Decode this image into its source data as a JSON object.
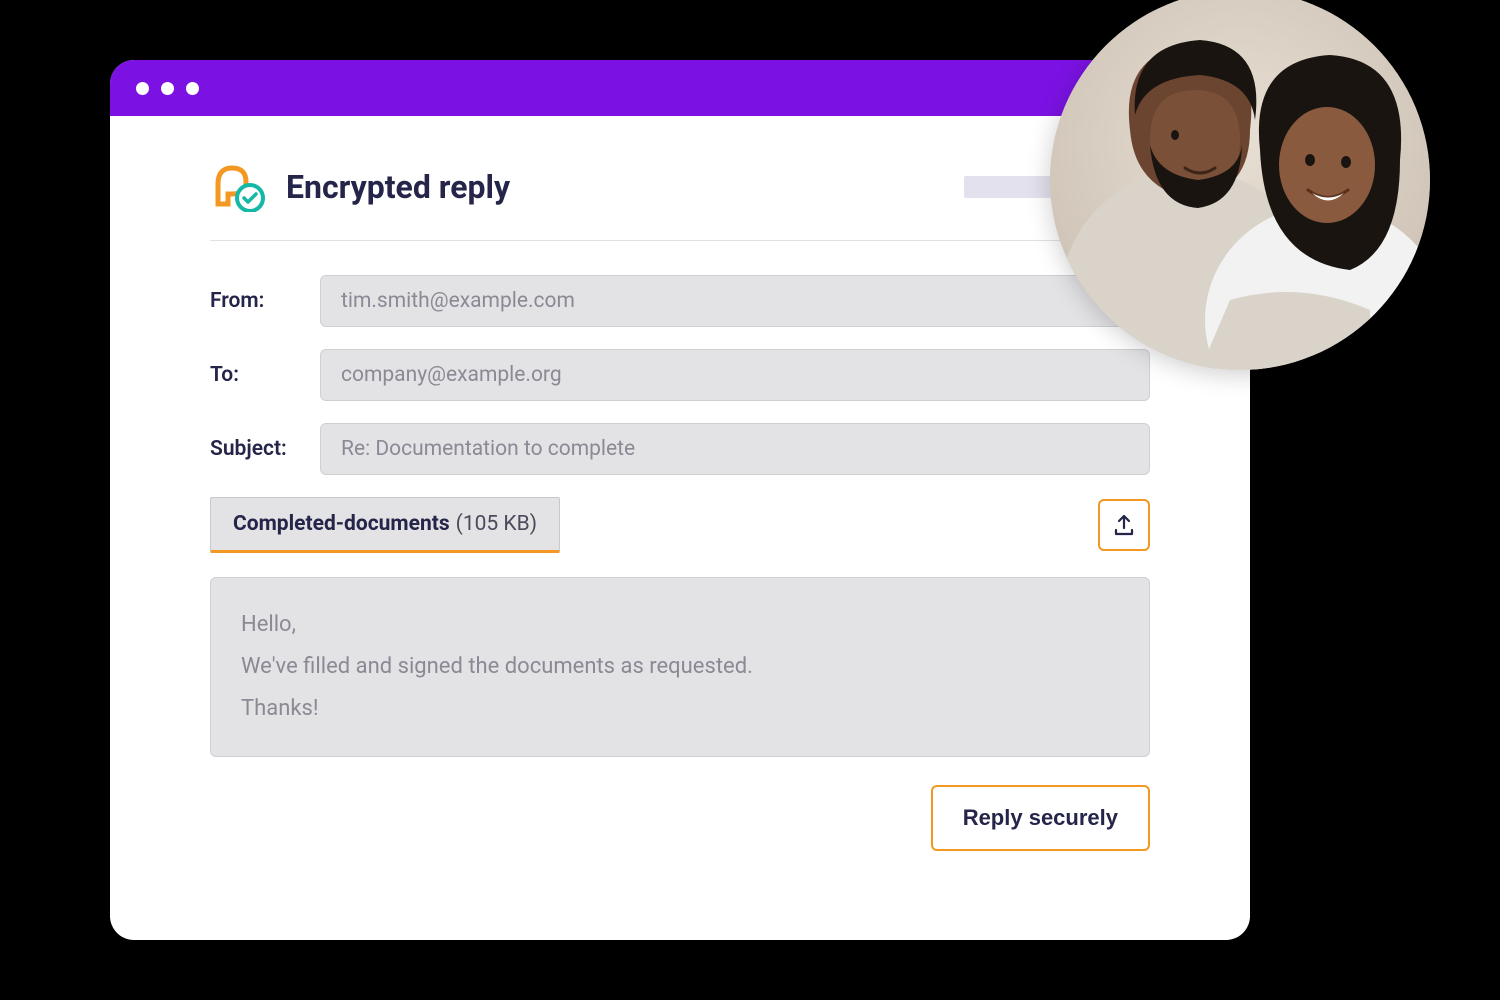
{
  "header": {
    "title": "Encrypted reply"
  },
  "fields": {
    "from_label": "From:",
    "from_value": "tim.smith@example.com",
    "to_label": "To:",
    "to_value": "company@example.org",
    "subject_label": "Subject:",
    "subject_value": "Re: Documentation to complete"
  },
  "attachment": {
    "name": "Completed-documents",
    "size": "(105 KB)"
  },
  "body": "Hello,\nWe've filled and signed the documents as requested.\nThanks!",
  "actions": {
    "reply_label": "Reply securely"
  },
  "colors": {
    "accent_purple": "#7b12e3",
    "accent_orange": "#f39822",
    "accent_teal": "#14b8a6",
    "text_dark": "#25254a"
  }
}
